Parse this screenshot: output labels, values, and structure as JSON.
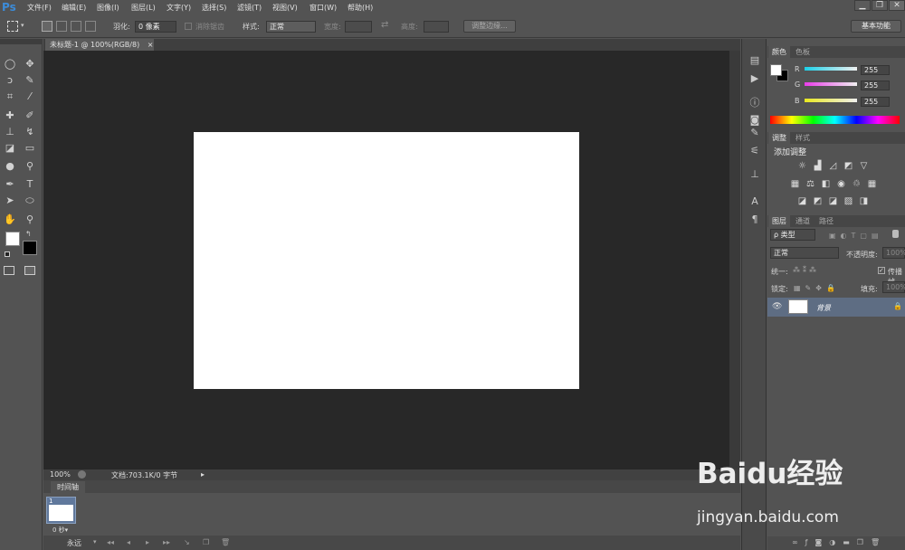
{
  "app": {
    "logo": "Ps"
  },
  "menu": {
    "items": [
      "文件(F)",
      "编辑(E)",
      "图像(I)",
      "图层(L)",
      "文字(Y)",
      "选择(S)",
      "滤镜(T)",
      "视图(V)",
      "窗口(W)",
      "帮助(H)"
    ]
  },
  "window_controls": {
    "minimize": "▁",
    "restore": "❐",
    "close": "✕"
  },
  "options": {
    "feather_label": "羽化:",
    "feather_value": "0 像素",
    "antialias_label": "消除锯齿",
    "style_label": "样式:",
    "style_value": "正常",
    "width_label": "宽度:",
    "height_label": "高度:",
    "swap": "⇄",
    "refine_edge": "调整边缘...",
    "workspace": "基本功能"
  },
  "document": {
    "tab_title": "未标题-1 @ 100%(RGB/8)",
    "tab_close": "×",
    "zoom": "100%",
    "doc_info": "文档:703.1K/0 字节"
  },
  "timeline": {
    "tab": "时间轴",
    "frame_number": "1",
    "frame_delay": "0 秒▾",
    "loop": "永远"
  },
  "color_panel": {
    "tabs": [
      "颜色",
      "色板"
    ],
    "channels": [
      {
        "label": "R",
        "value": "255",
        "color": "#27d0e6"
      },
      {
        "label": "G",
        "value": "255",
        "color": "#e040e0"
      },
      {
        "label": "B",
        "value": "255",
        "color": "#e8e833"
      }
    ]
  },
  "adjust_panel": {
    "tabs": [
      "调整",
      "样式"
    ],
    "title": "添加调整"
  },
  "layers_panel": {
    "tabs": [
      "图层",
      "通道",
      "路径"
    ],
    "filter_kind": "ρ 类型",
    "blend_mode": "正常",
    "opacity_label": "不透明度:",
    "opacity_value": "100%",
    "unify_label": "统一:",
    "propagate_label": "传播帧",
    "lock_label": "锁定:",
    "fill_label": "填充:",
    "fill_value": "100%",
    "layers": [
      {
        "name": "背景"
      }
    ]
  },
  "watermark": {
    "brand": "Baidu经验",
    "url": "jingyan.baidu.com"
  }
}
